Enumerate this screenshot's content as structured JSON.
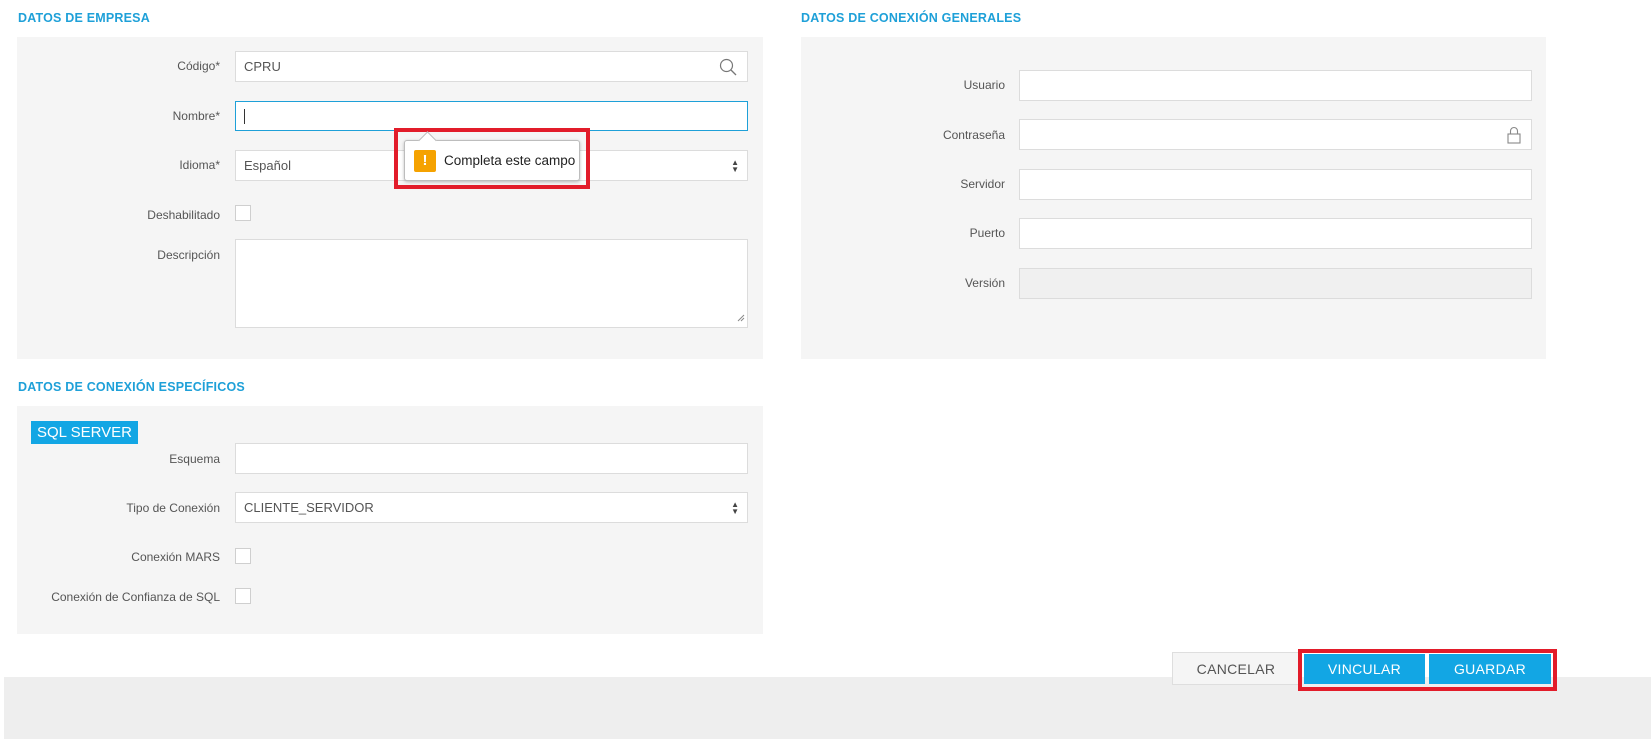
{
  "empresa": {
    "title": "DATOS DE EMPRESA",
    "codigo_label": "Código*",
    "codigo_value": "CPRU",
    "nombre_label": "Nombre*",
    "nombre_value": "",
    "idioma_label": "Idioma*",
    "idioma_value": "Español",
    "deshabilitado_label": "Deshabilitado",
    "descripcion_label": "Descripción"
  },
  "tooltip": {
    "text": "Completa este campo",
    "icon": "warning-icon",
    "icon_color": "#f5a200"
  },
  "generales": {
    "title": "DATOS DE CONEXIÓN GENERALES",
    "usuario_label": "Usuario",
    "contrasena_label": "Contraseña",
    "servidor_label": "Servidor",
    "puerto_label": "Puerto",
    "version_label": "Versión"
  },
  "especificos": {
    "title": "DATOS DE CONEXIÓN ESPECÍFICOS",
    "engine_tag": "SQL SERVER",
    "esquema_label": "Esquema",
    "tipo_label": "Tipo de Conexión",
    "tipo_value": "CLIENTE_SERVIDOR",
    "mars_label": "Conexión MARS",
    "confianza_label": "Conexión de Confianza de SQL"
  },
  "footer": {
    "cancel_label": "CANCELAR",
    "vincular_label": "VINCULAR",
    "guardar_label": "GUARDAR"
  },
  "colors": {
    "accent": "#12a6e4",
    "section_title": "#1ea0d8",
    "highlight": "#e21c2a"
  }
}
